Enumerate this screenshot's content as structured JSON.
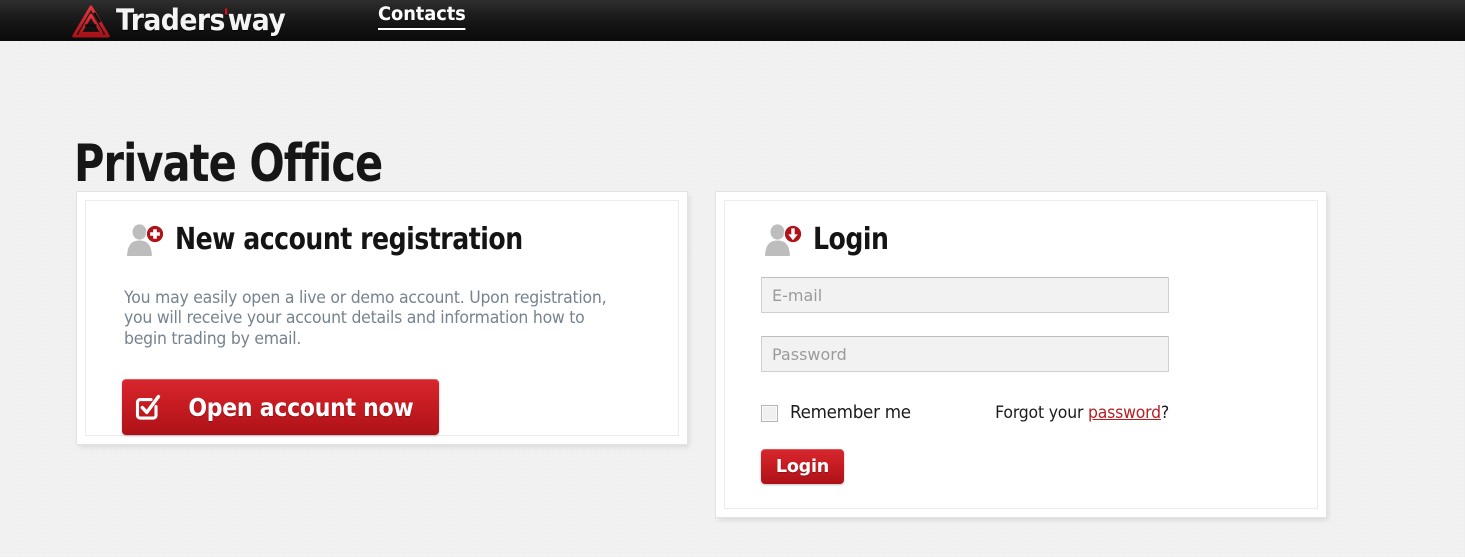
{
  "header": {
    "logo_text_part1": "Traders",
    "logo_apostrophe": "'",
    "logo_text_part2": "way",
    "logo_icon_name": "penrose-triangle-logo-icon",
    "nav": [
      {
        "label": "Contacts",
        "name": "nav-link-contacts"
      }
    ]
  },
  "page": {
    "title": "Private Office",
    "background_color": "#f2f2f2",
    "accent_color": "#c81c23"
  },
  "register_panel": {
    "icon_name": "user-add-icon",
    "heading": "New account registration",
    "body_text": "You may easily open a live or demo account. Upon registration, you will receive your account details and information how to begin trading by email.",
    "button_label": "Open account now",
    "button_icon_name": "checkbox-check-icon",
    "button_color": "#c81c23"
  },
  "login_panel": {
    "icon_name": "user-login-icon",
    "heading": "Login",
    "email": {
      "placeholder": "E-mail",
      "value": ""
    },
    "password": {
      "placeholder": "Password",
      "value": ""
    },
    "remember_me_label": "Remember me",
    "remember_me_checked": false,
    "forgot_prefix": "Forgot your ",
    "forgot_link": "password",
    "forgot_suffix": "?",
    "login_button_label": "Login",
    "link_color": "#b81d22"
  }
}
